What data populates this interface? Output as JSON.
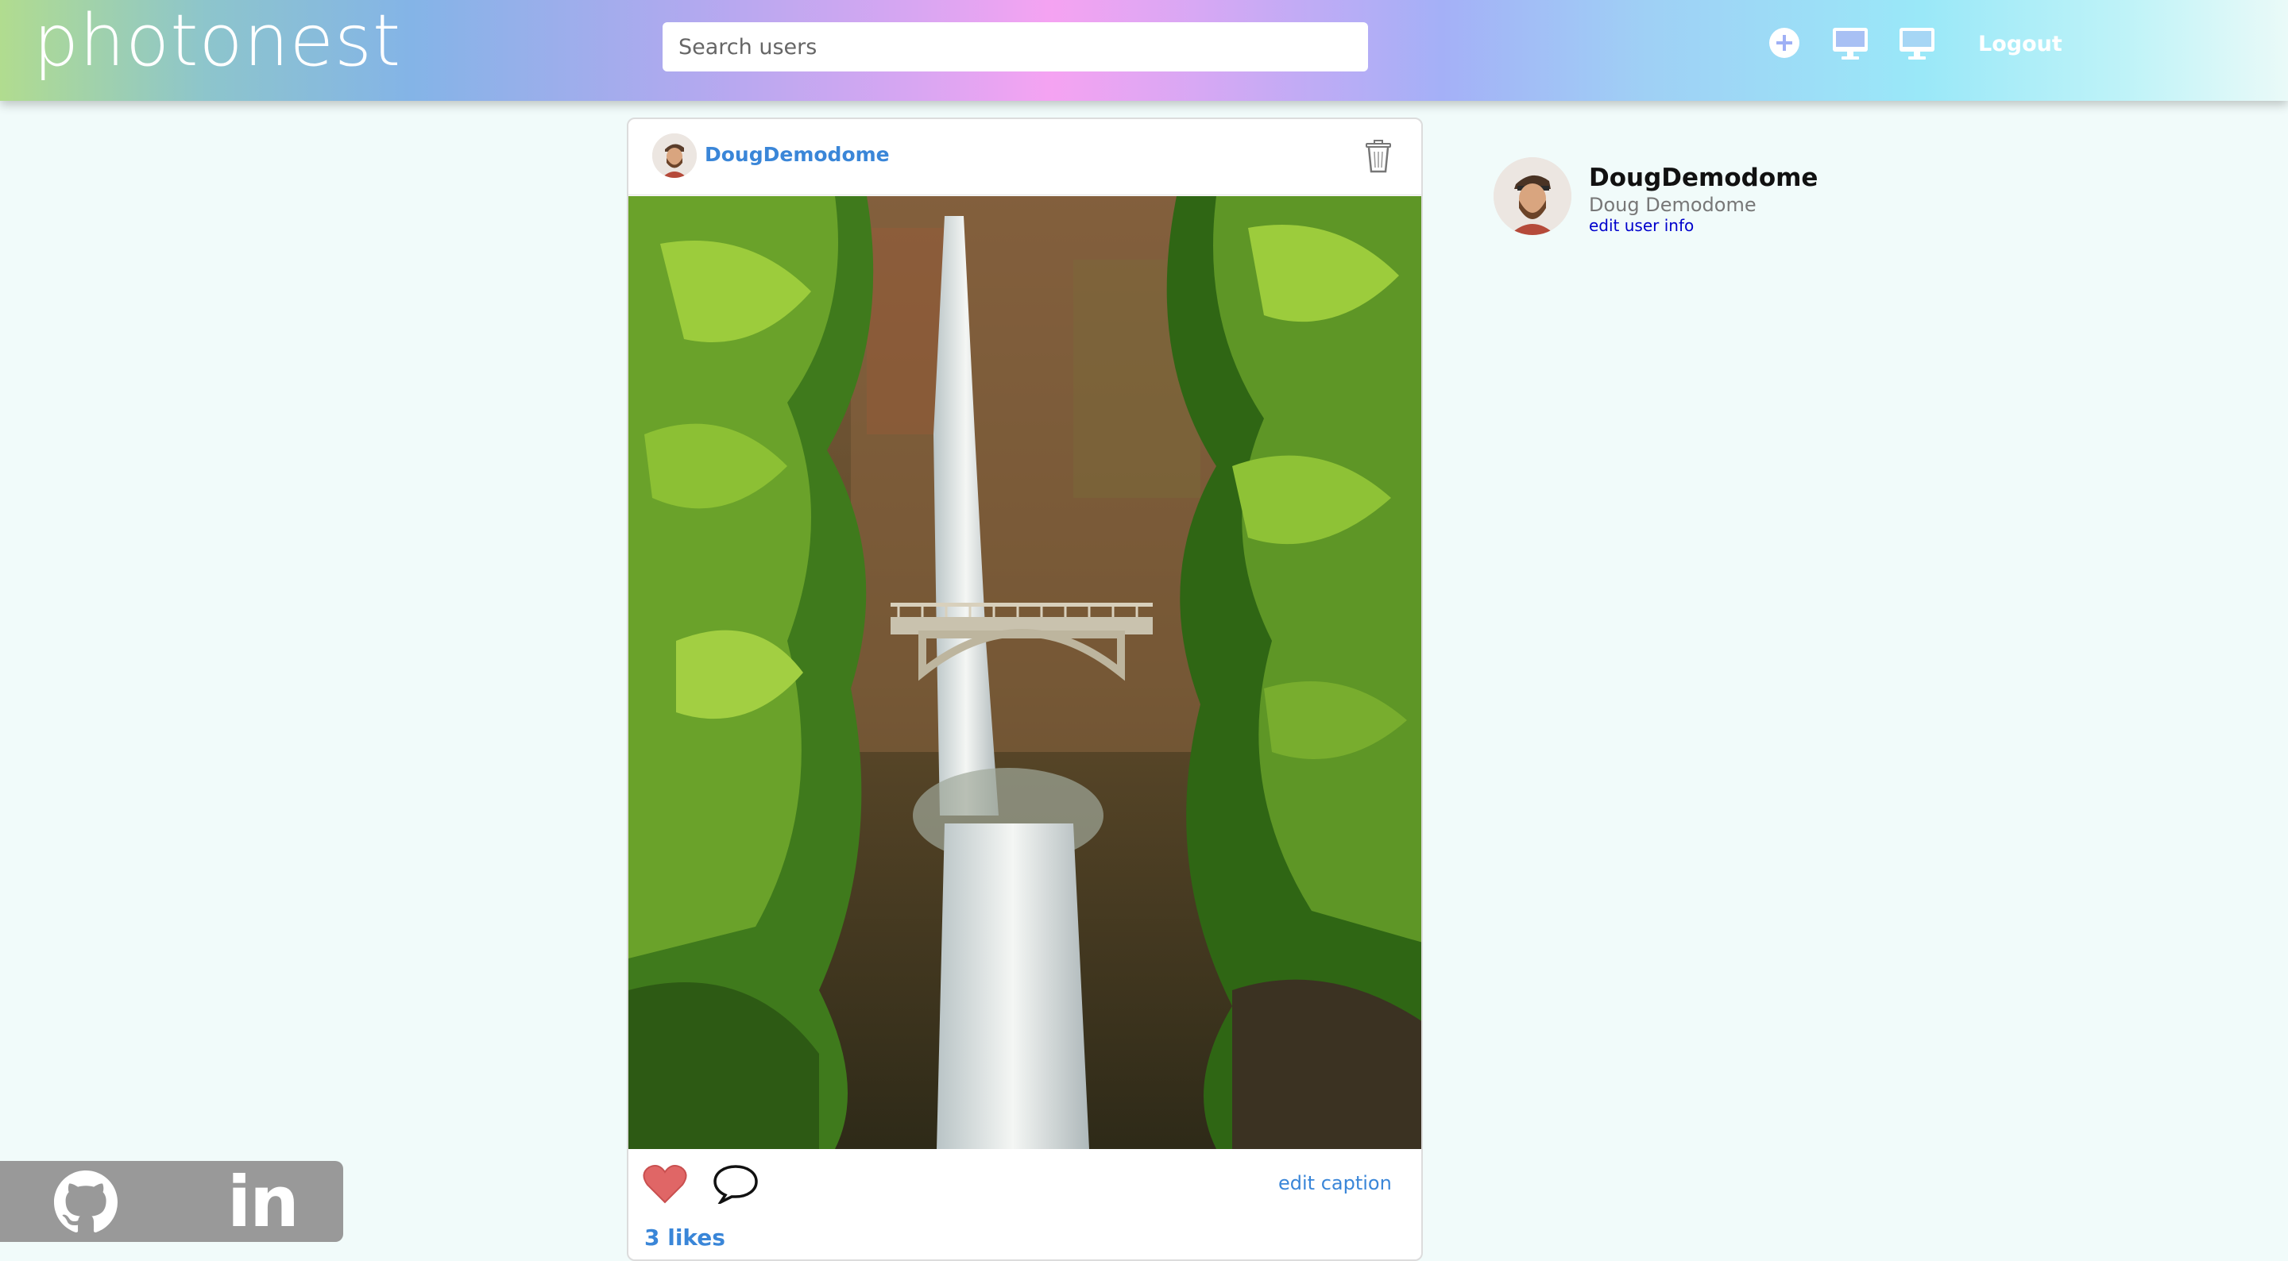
{
  "header": {
    "logo": "photonest",
    "search": {
      "placeholder": "Search users",
      "value": ""
    },
    "nav_icons": [
      "plus-circle-icon",
      "desktop-icon",
      "desktop-icon"
    ],
    "logout_label": "Logout"
  },
  "post": {
    "username": "DougDemodome",
    "image_alt": "Waterfall with stone footbridge in green forest",
    "edit_caption_label": "edit caption",
    "likes_label": "3 likes",
    "icons": [
      "trash-icon",
      "heart-icon",
      "comment-icon"
    ]
  },
  "profile": {
    "username": "DougDemodome",
    "full_name": "Doug Demodome",
    "edit_link": "edit user info"
  },
  "social": {
    "icons": [
      "github-icon",
      "linkedin-icon"
    ],
    "linkedin_text": "in"
  },
  "colors": {
    "link_blue": "#3a86d8",
    "page_bg": "#f1fbfa",
    "heart_red": "#e06666",
    "social_bg": "#999999"
  }
}
